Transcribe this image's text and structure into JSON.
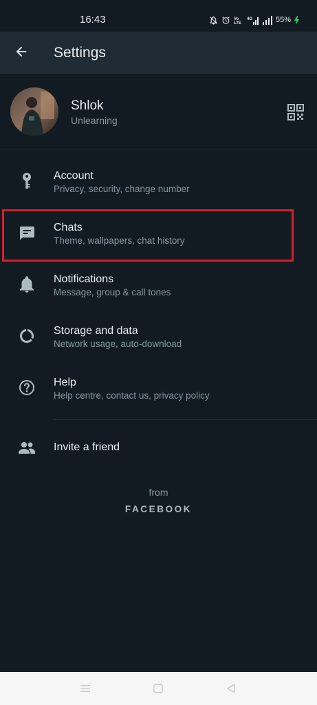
{
  "status_bar": {
    "time": "16:43",
    "battery": "55%",
    "icons": [
      "mute-bell-icon",
      "alarm-icon",
      "volte-icon",
      "4g-signal-icon",
      "signal-icon",
      "battery-charging-icon"
    ],
    "volte_label": "VoLTE",
    "network_label": "4G"
  },
  "app_bar": {
    "title": "Settings",
    "back_icon": "arrow-left-icon"
  },
  "profile": {
    "name": "Shlok",
    "status": "Unlearning",
    "qr_icon": "qr-code-icon"
  },
  "menu": {
    "items": [
      {
        "icon": "key-icon",
        "title": "Account",
        "subtitle": "Privacy, security, change number"
      },
      {
        "icon": "chat-icon",
        "title": "Chats",
        "subtitle": "Theme, wallpapers, chat history"
      },
      {
        "icon": "bell-icon",
        "title": "Notifications",
        "subtitle": "Message, group & call tones"
      },
      {
        "icon": "storage-icon",
        "title": "Storage and data",
        "subtitle": "Network usage, auto-download"
      },
      {
        "icon": "help-icon",
        "title": "Help",
        "subtitle": "Help centre, contact us, privacy policy"
      }
    ],
    "invite": {
      "icon": "people-icon",
      "label": "Invite a friend"
    }
  },
  "footer": {
    "from": "from",
    "brand": "FACEBOOK"
  },
  "colors": {
    "background": "#121b22",
    "app_bar": "#202c33",
    "primary_text": "#e9edef",
    "secondary_text": "#8696a0",
    "icon": "#aebac1",
    "highlight": "#d3222a",
    "nav_bar": "#f6f6f6"
  },
  "nav_bar": {
    "icons": [
      "menu-icon",
      "home-icon",
      "back-triangle-icon"
    ]
  }
}
